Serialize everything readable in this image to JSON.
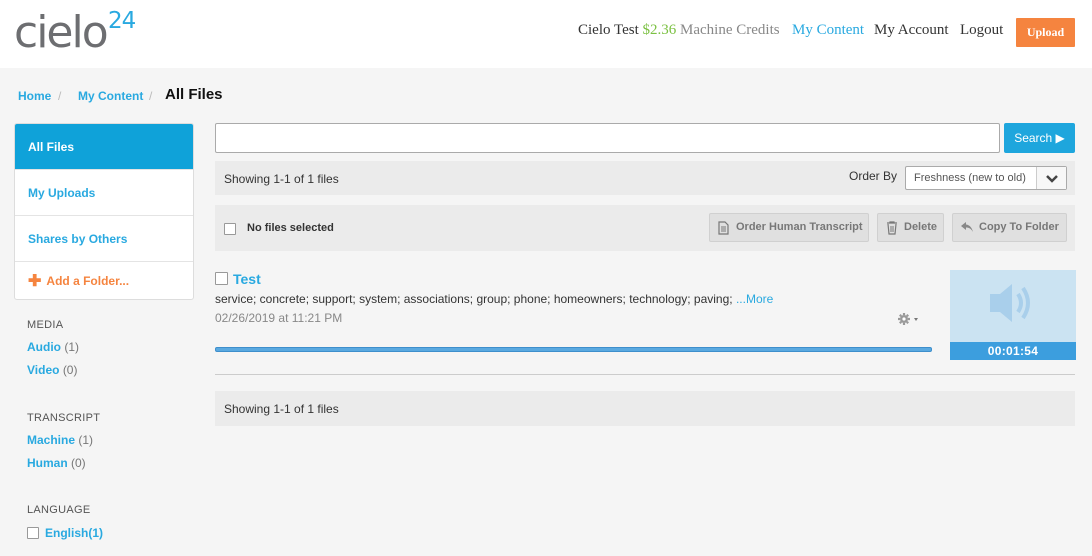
{
  "header": {
    "logo_word": "cielo",
    "logo_number": "24",
    "user_name": "Cielo Test",
    "credits_amount": "$2.36",
    "credits_label": "Machine Credits",
    "nav": {
      "my_content": "My Content",
      "my_account": "My Account",
      "logout": "Logout"
    },
    "upload_label": "Upload",
    "accent_color": "#29a9e0",
    "upload_color": "#f5843f"
  },
  "breadcrumb": {
    "home": "Home",
    "my_content": "My Content",
    "current": "All Files",
    "separator": "/"
  },
  "sidebar": {
    "items": [
      {
        "label": "All Files",
        "active": true
      },
      {
        "label": "My Uploads"
      },
      {
        "label": "Shares by Others"
      }
    ],
    "add_folder_label": "Add a Folder...",
    "filters": {
      "media": {
        "heading": "MEDIA",
        "audio": "Audio",
        "audio_count": "(1)",
        "video": "Video",
        "video_count": "(0)"
      },
      "transcript": {
        "heading": "TRANSCRIPT",
        "machine": "Machine",
        "machine_count": "(1)",
        "human": "Human",
        "human_count": "(0)"
      },
      "language": {
        "heading": "LANGUAGE",
        "english": "English(1)"
      }
    }
  },
  "main": {
    "search": {
      "value": "",
      "button_label": "Search ▶"
    },
    "showing_text": "Showing 1-1 of 1 files",
    "order_by_label": "Order By",
    "order_by_value": "Freshness (new to old)",
    "selection_text": "No files selected",
    "actions": {
      "order_human": "Order Human Transcript",
      "delete": "Delete",
      "copy_to_folder": "Copy To Folder"
    },
    "file": {
      "title": "Test",
      "keywords": "service; concrete; support; system; associations; group; phone; homeowners; technology; paving;",
      "more_label": "...More",
      "date": "02/26/2019 at 11:21 PM",
      "duration": "00:01:54",
      "progress": 1.0,
      "icon": "speaker-icon"
    },
    "footer_showing_text": "Showing 1-1 of 1 files"
  }
}
